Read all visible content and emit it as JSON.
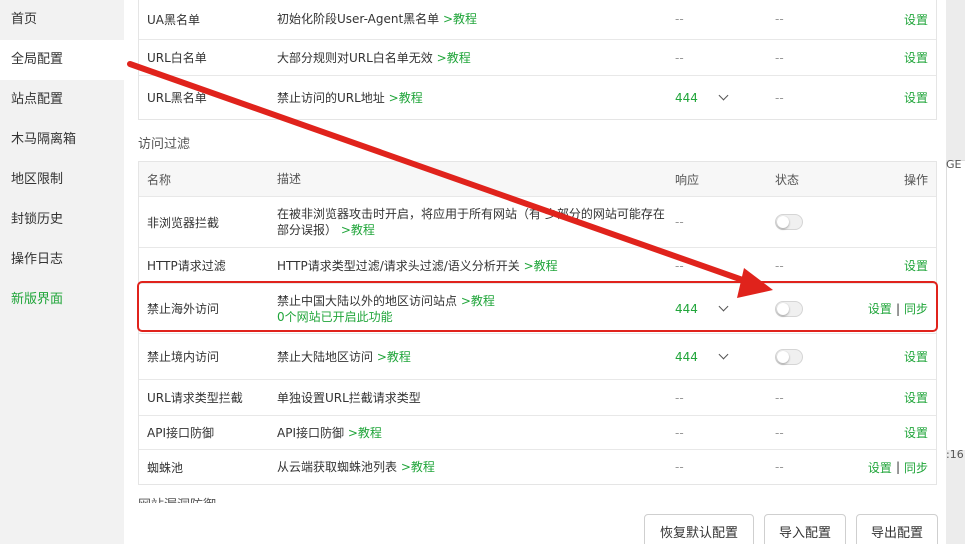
{
  "sidebar": {
    "items": [
      {
        "label": "首页"
      },
      {
        "label": "全局配置"
      },
      {
        "label": "站点配置"
      },
      {
        "label": "木马隔离箱"
      },
      {
        "label": "地区限制"
      },
      {
        "label": "封锁历史"
      },
      {
        "label": "操作日志"
      },
      {
        "label": "新版界面"
      }
    ]
  },
  "top_table": {
    "rows": [
      {
        "name": "UA黑名单",
        "desc": "初始化阶段User-Agent黑名单",
        "tutorial": ">教程",
        "resp": "--",
        "state": "--",
        "ops": "设置"
      },
      {
        "name": "URL白名单",
        "desc": "大部分规则对URL白名单无效",
        "tutorial": ">教程",
        "resp": "--",
        "state": "--",
        "ops": "设置"
      },
      {
        "name": "URL黑名单",
        "desc": "禁止访问的URL地址",
        "tutorial": ">教程",
        "resp": "444",
        "state": "--",
        "ops": "设置"
      }
    ]
  },
  "access_filter": {
    "title": "访问过滤",
    "headers": {
      "name": "名称",
      "desc": "描述",
      "resp": "响应",
      "state": "状态",
      "ops": "操作"
    },
    "rows": [
      {
        "name": "非浏览器拦截",
        "desc": "在被非浏览器攻击时开启，将应用于所有网站（有 少部分的网站可能存在",
        "desc2": "部分误报）",
        "tutorial": ">教程",
        "resp": "--",
        "ops": ""
      },
      {
        "name": "HTTP请求过滤",
        "desc": "HTTP请求类型过滤/请求头过滤/语义分析开关",
        "tutorial": ">教程",
        "resp": "--",
        "state": "--",
        "ops": "设置"
      },
      {
        "name": "禁止海外访问",
        "desc": "禁止中国大陆以外的地区访问站点",
        "tutorial": ">教程",
        "note": "0个网站已开启此功能",
        "resp": "444",
        "ops": "设置",
        "ops2": "同步"
      },
      {
        "name": "禁止境内访问",
        "desc": "禁止大陆地区访问",
        "tutorial": ">教程",
        "resp": "444",
        "ops": "设置"
      },
      {
        "name": "URL请求类型拦截",
        "desc": "单独设置URL拦截请求类型",
        "resp": "--",
        "state": "--",
        "ops": "设置"
      },
      {
        "name": "API接口防御",
        "desc": "API接口防御",
        "tutorial": ">教程",
        "resp": "--",
        "state": "--",
        "ops": "设置"
      },
      {
        "name": "蜘蛛池",
        "desc": "从云端获取蜘蛛池列表",
        "tutorial": ">教程",
        "resp": "--",
        "state": "--",
        "ops": "设置",
        "ops2": "同步"
      }
    ]
  },
  "next_section_title": "网站漏洞防御",
  "buttons": {
    "restore": "恢复默认配置",
    "import": "导入配置",
    "export": "导出配置"
  },
  "right_strip": {
    "text1": "GE",
    "text2": ":16"
  },
  "colors": {
    "accent": "#20a53a",
    "annotation": "#e0231c"
  }
}
